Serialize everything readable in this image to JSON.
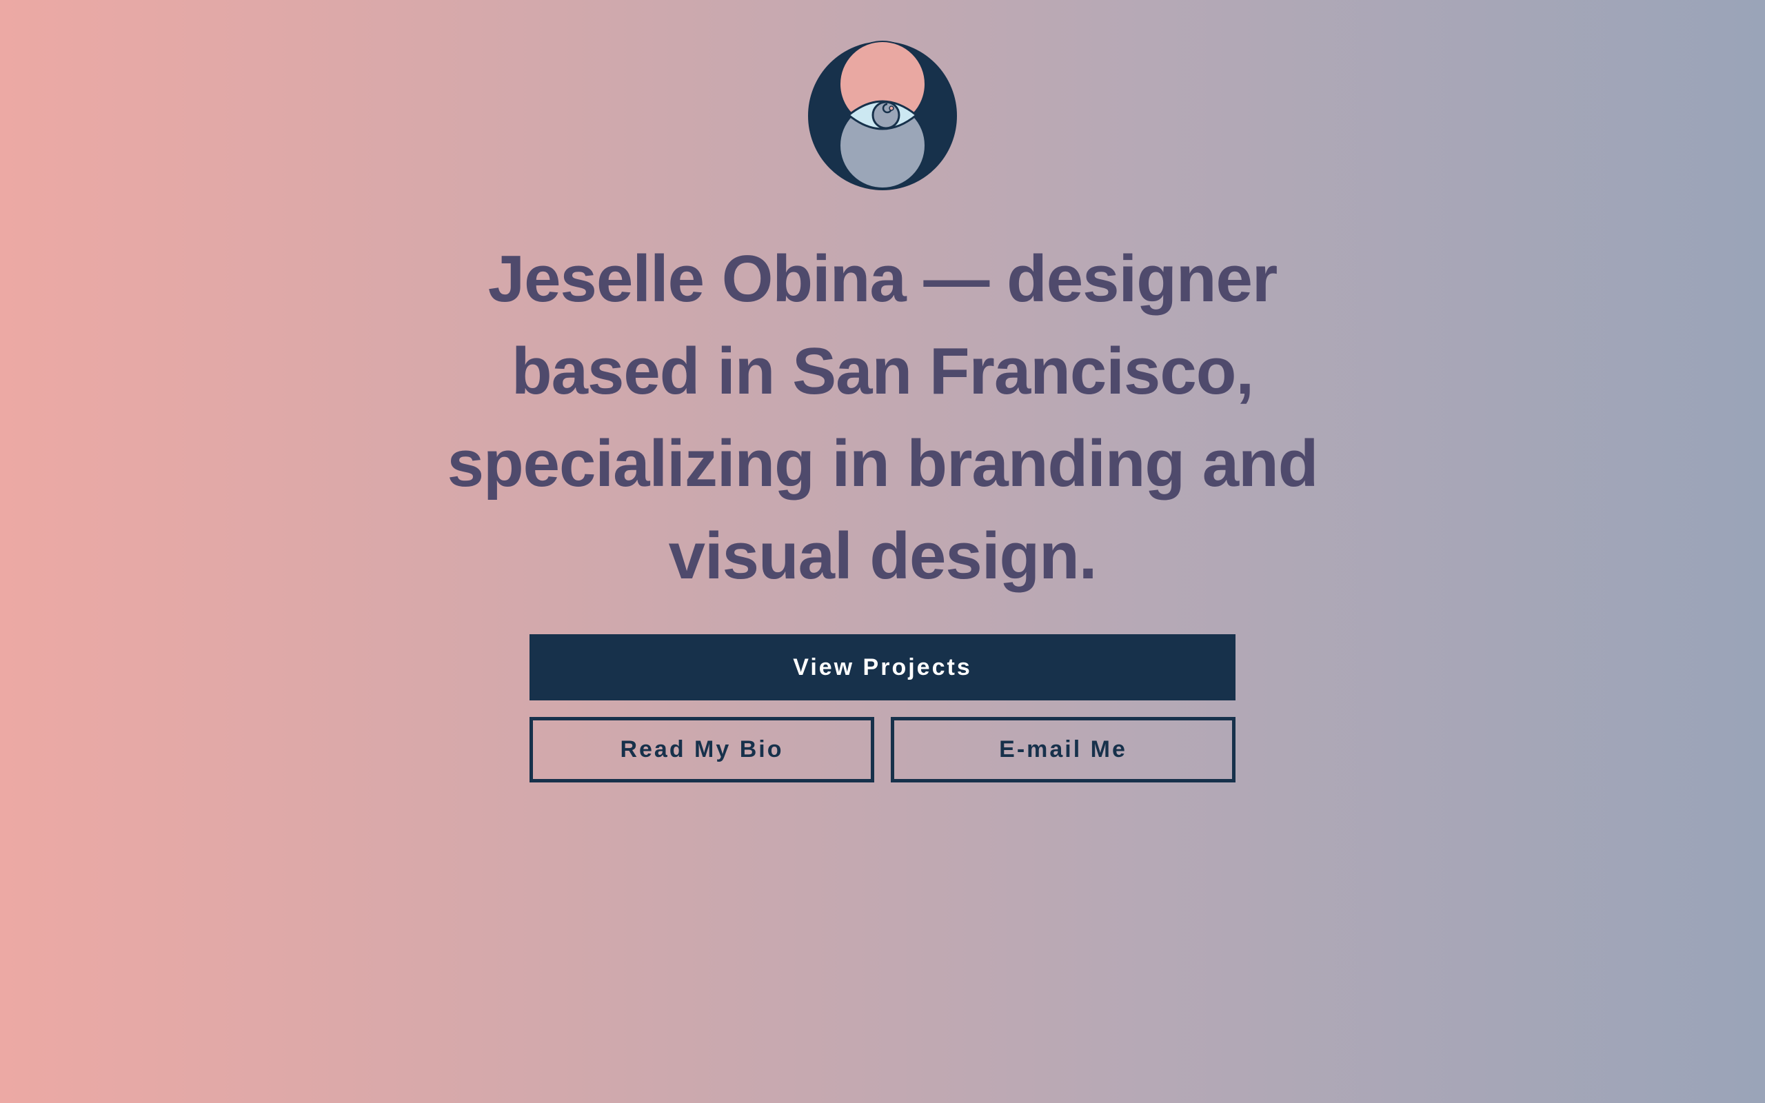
{
  "hero": {
    "headline": "Jeselle Obina — designer based in San Francisco, specializing in branding and visual design."
  },
  "actions": {
    "view_projects": "View Projects",
    "read_bio": "Read My Bio",
    "email_me": "E-mail Me"
  },
  "logo": {
    "icon": "eye-icon"
  },
  "colors": {
    "background_left": "#eca9a4",
    "background_right": "#9aa4b8",
    "headline": "#4f4a6c",
    "primary": "#17314b",
    "logo_pink": "#e9a8a2",
    "logo_blue": "#9ba6b8",
    "logo_eye": "#cce8f2"
  }
}
